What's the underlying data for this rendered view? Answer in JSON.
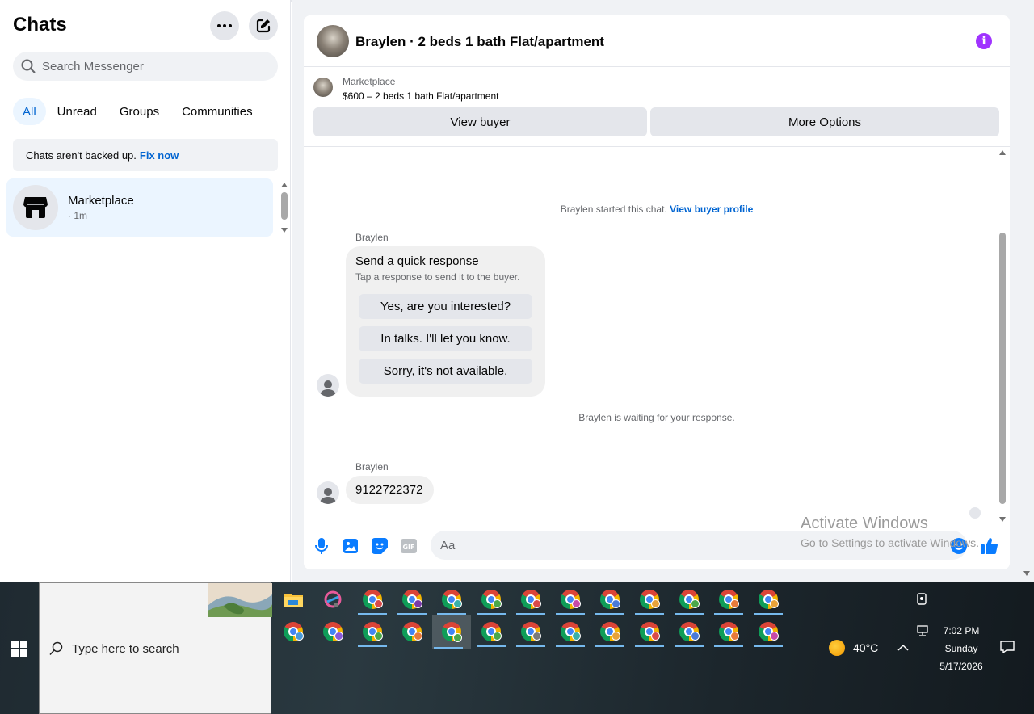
{
  "sidebar": {
    "title": "Chats",
    "more_icon": "ellipsis-icon",
    "compose_icon": "compose-icon",
    "search_placeholder": "Search Messenger",
    "filters": [
      "All",
      "Unread",
      "Groups",
      "Communities"
    ],
    "active_filter": "All",
    "backup_text": "Chats aren't backed up.",
    "backup_link": "Fix now",
    "chats": [
      {
        "name": "Marketplace",
        "time": "· 1m",
        "icon": "store-icon"
      }
    ]
  },
  "conversation": {
    "title": "Braylen · 2 beds 1 bath Flat/apartment",
    "marketplace_label": "Marketplace",
    "listing_price": "$600 – 2 beds 1 bath Flat/apartment",
    "view_buyer_label": "View buyer",
    "more_options_label": "More Options",
    "started_text": "Braylen started this chat.",
    "view_profile_link": "View buyer profile",
    "messages": [
      {
        "sender": "Braylen",
        "type": "quick-response",
        "title": "Send a quick response",
        "subtitle": "Tap a response to send it to the buyer.",
        "options": [
          "Yes, are you interested?",
          "In talks. I'll let you know.",
          "Sorry, it's not available."
        ]
      },
      {
        "sender": "Braylen",
        "type": "text",
        "text": "9122722372"
      }
    ],
    "waiting_text": "Braylen is waiting for your response.",
    "composer_placeholder": "Aa"
  },
  "watermark": {
    "line1": "Activate Windows",
    "line2": "Go to Settings to activate Windows."
  },
  "taskbar": {
    "search_placeholder": "Type here to search",
    "weather_temp": "40°C",
    "time": "7:02 PM",
    "day": "Sunday",
    "date": "5/17/2026",
    "accent": "#76b9ed"
  },
  "colors": {
    "accent": "#0064d1",
    "info": "#a033ff",
    "messenger_blue": "#0a7cff"
  }
}
